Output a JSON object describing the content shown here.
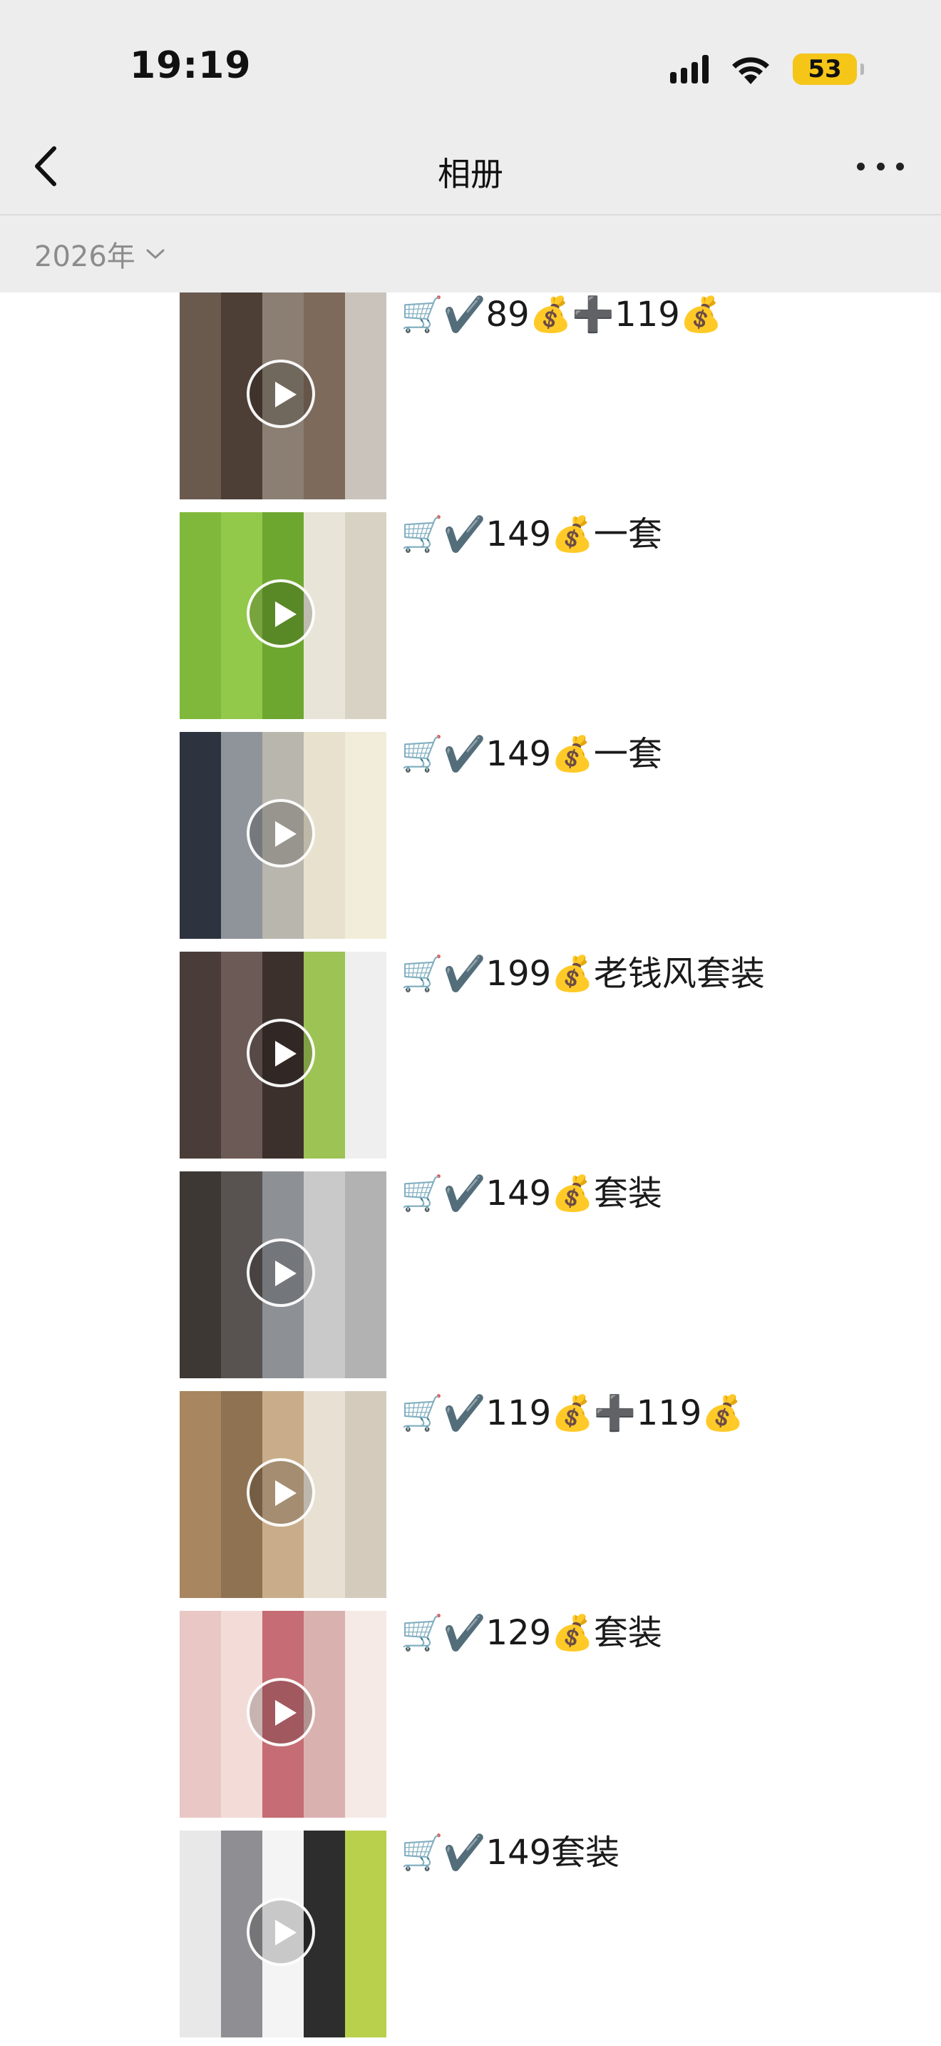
{
  "status_bar": {
    "time": "19:19",
    "battery": "53",
    "battery_color": "#f5c518"
  },
  "nav": {
    "title": "相册",
    "back_icon": "chevron-left-icon",
    "more_icon": "more-dots-icon"
  },
  "filter": {
    "year": "2026年",
    "dropdown_icon": "chevron-down-icon"
  },
  "posts": [
    {
      "caption": "🛒✔️89💰➕119💰",
      "colors": [
        "#6a5a4e",
        "#4d3f36",
        "#8a7f72",
        "#7d6a5b",
        "#c9c3bb"
      ]
    },
    {
      "caption": "🛒✔️149💰一套",
      "colors": [
        "#7fb83a",
        "#92c94a",
        "#6da72f",
        "#e9e4d8",
        "#d8d2c4"
      ]
    },
    {
      "caption": "🛒✔️149💰一套",
      "colors": [
        "#2e3340",
        "#8f949a",
        "#b9b6ad",
        "#e8e1cd",
        "#f2ecdb"
      ]
    },
    {
      "caption": "🛒✔️199💰老钱风套装",
      "colors": [
        "#4a3c38",
        "#6b5a56",
        "#3c302d",
        "#9cc354",
        "#efefef"
      ]
    },
    {
      "caption": "🛒✔️149💰套装",
      "colors": [
        "#3e3835",
        "#585250",
        "#8d9095",
        "#c9c9c9",
        "#b2b2b2"
      ]
    },
    {
      "caption": "🛒✔️119💰➕119💰",
      "colors": [
        "#a8865f",
        "#8f7252",
        "#c9ad8a",
        "#e8e0d3",
        "#d5cbbd"
      ]
    },
    {
      "caption": "🛒✔️129💰套装",
      "colors": [
        "#e9c7c4",
        "#f3dcd8",
        "#c56c74",
        "#d9b2b0",
        "#f6eae6"
      ]
    },
    {
      "caption": "🛒✔️149套装",
      "colors": [
        "#e8e8e8",
        "#8f8f93",
        "#f4f4f4",
        "#2d2d2d",
        "#b8d04c"
      ]
    }
  ]
}
